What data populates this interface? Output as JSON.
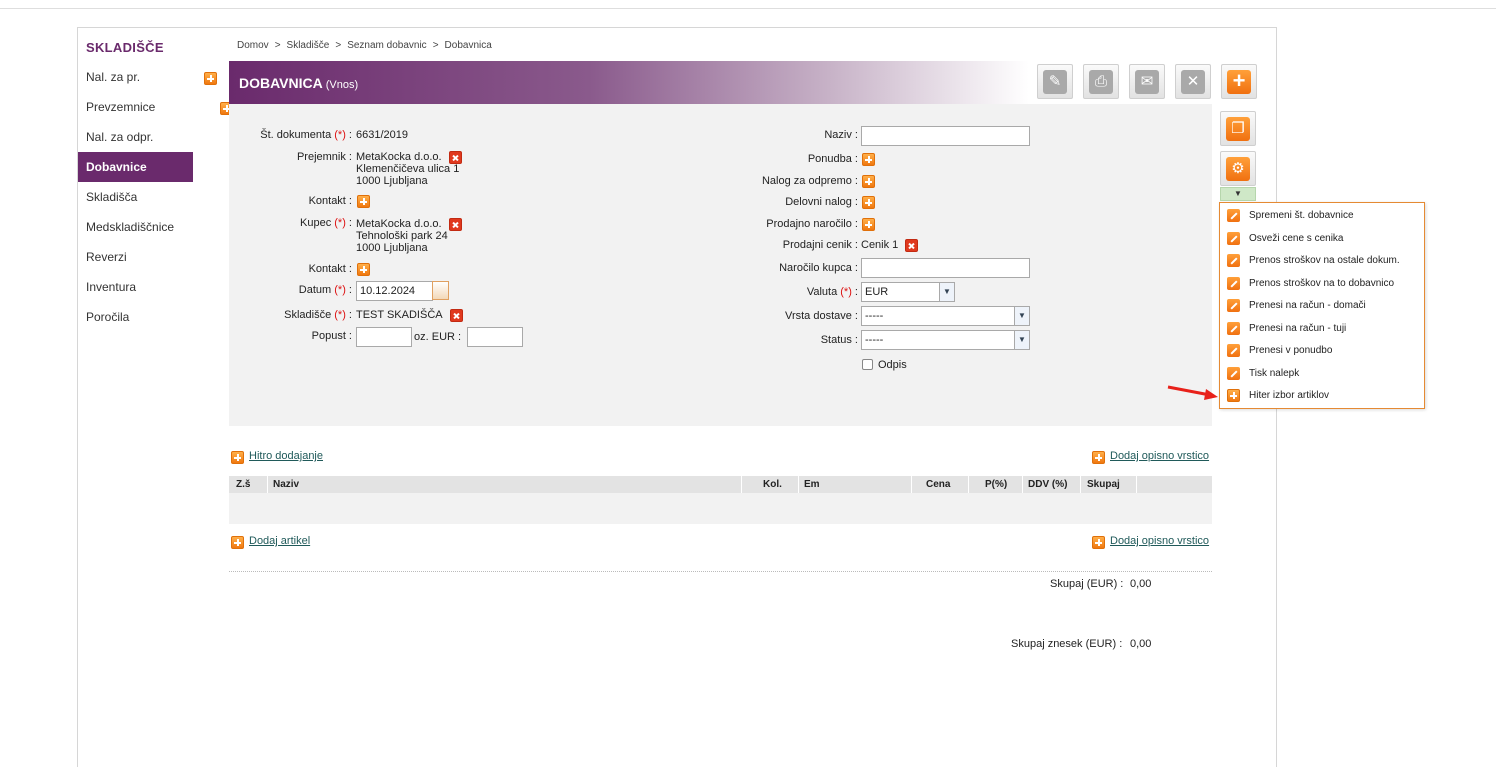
{
  "sidebar": {
    "title": "SKLADIŠČE",
    "items": [
      {
        "label": "Nal. za pr.",
        "plus": true
      },
      {
        "label": "Prevzemnice",
        "plus": true
      },
      {
        "label": "Nal. za odpr.",
        "plus": true
      },
      {
        "label": "Dobavnice",
        "plus": true,
        "active": true
      },
      {
        "label": "Skladišča",
        "plus": true
      },
      {
        "label": "Medskladiščnice",
        "plus": true
      },
      {
        "label": "Reverzi",
        "plus": true
      },
      {
        "label": "Inventura",
        "plus": true
      },
      {
        "label": "Poročila",
        "plus": false
      }
    ]
  },
  "breadcrumb": [
    "Domov",
    "Skladišče",
    "Seznam dobavnic",
    "Dobavnica"
  ],
  "breadcrumb_sep": ">",
  "header": {
    "title": "DOBAVNICA",
    "subtitle": "(Vnos)"
  },
  "toolbar": [
    "edit-icon",
    "print-icon",
    "mail-icon",
    "close-icon",
    "add-icon"
  ],
  "form_left": {
    "st_dokumenta": {
      "label": "Št. dokumenta",
      "req": "(*)",
      "value": "6631/2019"
    },
    "prejemnik": {
      "label": "Prejemnik",
      "lines": [
        "MetaKocka d.o.o.",
        "Klemenčičeva ulica 1",
        "1000 Ljubljana"
      ]
    },
    "kontakt1": {
      "label": "Kontakt"
    },
    "kupec": {
      "label": "Kupec",
      "req": "(*)",
      "lines": [
        "MetaKocka d.o.o.",
        "Tehnološki park 24",
        "1000 Ljubljana"
      ]
    },
    "kontakt2": {
      "label": "Kontakt"
    },
    "datum": {
      "label": "Datum",
      "req": "(*)",
      "value": "10.12.2024"
    },
    "skladisce": {
      "label": "Skladišče",
      "req": "(*)",
      "value": "TEST SKADIŠČA"
    },
    "popust": {
      "label": "Popust",
      "oz": "oz. EUR :"
    }
  },
  "form_right": {
    "naziv": {
      "label": "Naziv",
      "value": ""
    },
    "ponudba": {
      "label": "Ponudba"
    },
    "nalog_za_odpremo": {
      "label": "Nalog za odpremo"
    },
    "delovni_nalog": {
      "label": "Delovni nalog"
    },
    "prodajno_narocilo": {
      "label": "Prodajno naročilo"
    },
    "prodajni_cenik": {
      "label": "Prodajni cenik",
      "value": "Cenik 1"
    },
    "narocilo_kupca": {
      "label": "Naročilo kupca",
      "value": ""
    },
    "valuta": {
      "label": "Valuta",
      "req": "(*)",
      "value": "EUR"
    },
    "vrsta_dostave": {
      "label": "Vrsta dostave",
      "value": "-----"
    },
    "status": {
      "label": "Status",
      "value": "-----"
    },
    "odpis": {
      "label": "Odpis",
      "checked": false
    }
  },
  "menu": {
    "items": [
      "Spremeni št. dobavnice",
      "Osveži cene s cenika",
      "Prenos stroškov na ostale dokum.",
      "Prenos stroškov na to dobavnico",
      "Prenesi na račun - domači",
      "Prenesi na račun - tuji",
      "Prenesi v ponudbo",
      "Tisk nalepk",
      "Hiter izbor artiklov"
    ]
  },
  "table": {
    "hitro_dodajanje": "Hitro dodajanje",
    "dodaj_opisno_vrstico": "Dodaj opisno vrstico",
    "dodaj_artikel": "Dodaj artikel",
    "columns": [
      "Z.š",
      "Naziv",
      "Kol.",
      "Em",
      "Cena",
      "P(%)",
      "DDV (%)",
      "Skupaj"
    ]
  },
  "totals": {
    "skupaj_label": "Skupaj (EUR) :",
    "skupaj_value": "0,00",
    "skupaj_znesek_label": "Skupaj znesek (EUR) :",
    "skupaj_znesek_value": "0,00"
  },
  "colors": {
    "brand": "#6a2a6c",
    "accent": "#f07810",
    "danger": "#e0391e"
  }
}
